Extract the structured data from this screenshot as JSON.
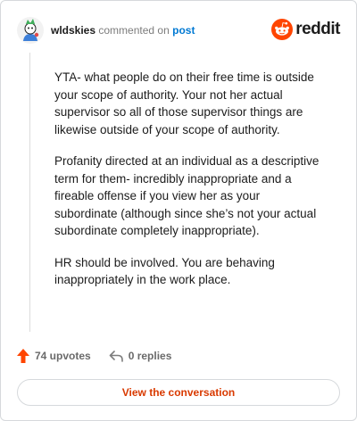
{
  "header": {
    "username": "wldskies",
    "action_text": "commented on",
    "post_link": "post",
    "brand": "reddit"
  },
  "comment": {
    "paragraphs": [
      "YTA- what people do on their free time is outside your scope of authority. Your not her actual supervisor so all of those supervisor things are likewise outside of your scope of authority.",
      "Profanity directed at an individual as a descriptive term for them- incredibly inappropriate and a fireable offense if you view her as your subordinate (although since she’s not your actual subordinate completely inappropriate).",
      "HR should be involved. You are behaving inappropriately in the work place."
    ]
  },
  "actions": {
    "upvotes": "74 upvotes",
    "replies": "0 replies"
  },
  "cta": {
    "label": "View the conversation"
  },
  "colors": {
    "brand_orange": "#ff4500",
    "link_blue": "#0079d3",
    "cta_text": "#d93a00"
  }
}
